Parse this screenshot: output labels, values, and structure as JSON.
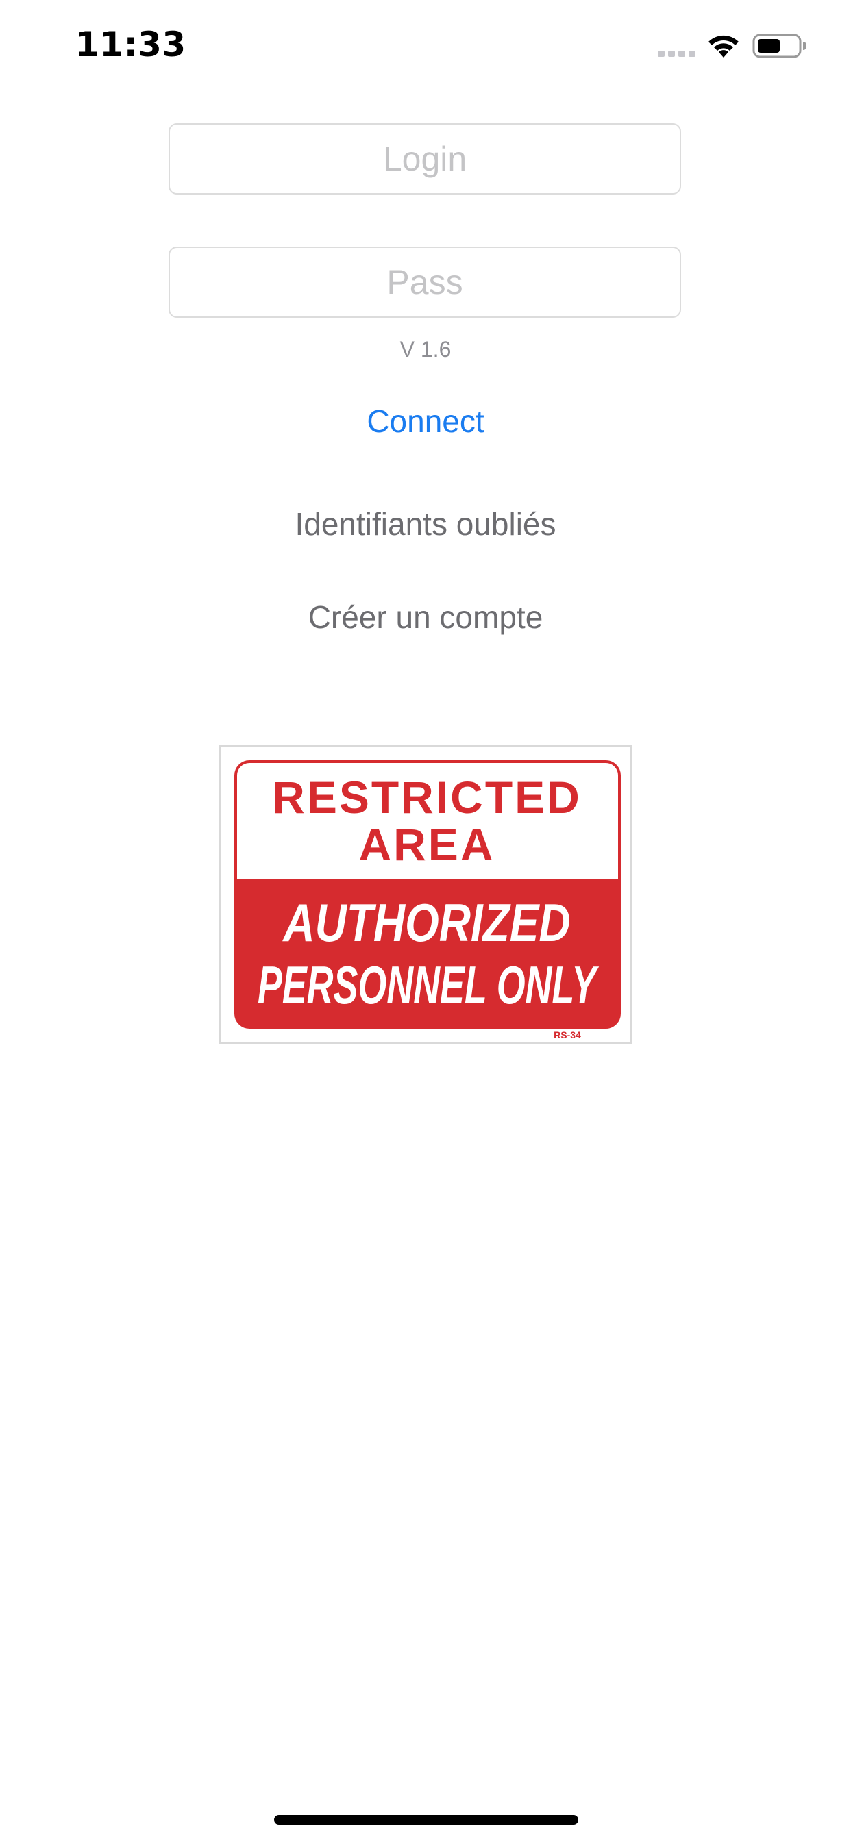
{
  "status_bar": {
    "time": "11:33"
  },
  "login_form": {
    "login_placeholder": "Login",
    "login_value": "",
    "pass_placeholder": "Pass",
    "pass_value": "",
    "version": "V 1.6",
    "connect_label": "Connect",
    "forgot_label": "Identifiants oubliés",
    "create_label": "Créer un compte"
  },
  "sign": {
    "line1": "RESTRICTED",
    "line2": "AREA",
    "line3": "AUTHORIZED",
    "line4": "PERSONNEL ONLY",
    "code": "RS-34",
    "color_red": "#d62b2f"
  },
  "colors": {
    "accent": "#1a7cf0",
    "secondary_text": "#6c6c70",
    "placeholder": "#c4c4c6"
  }
}
